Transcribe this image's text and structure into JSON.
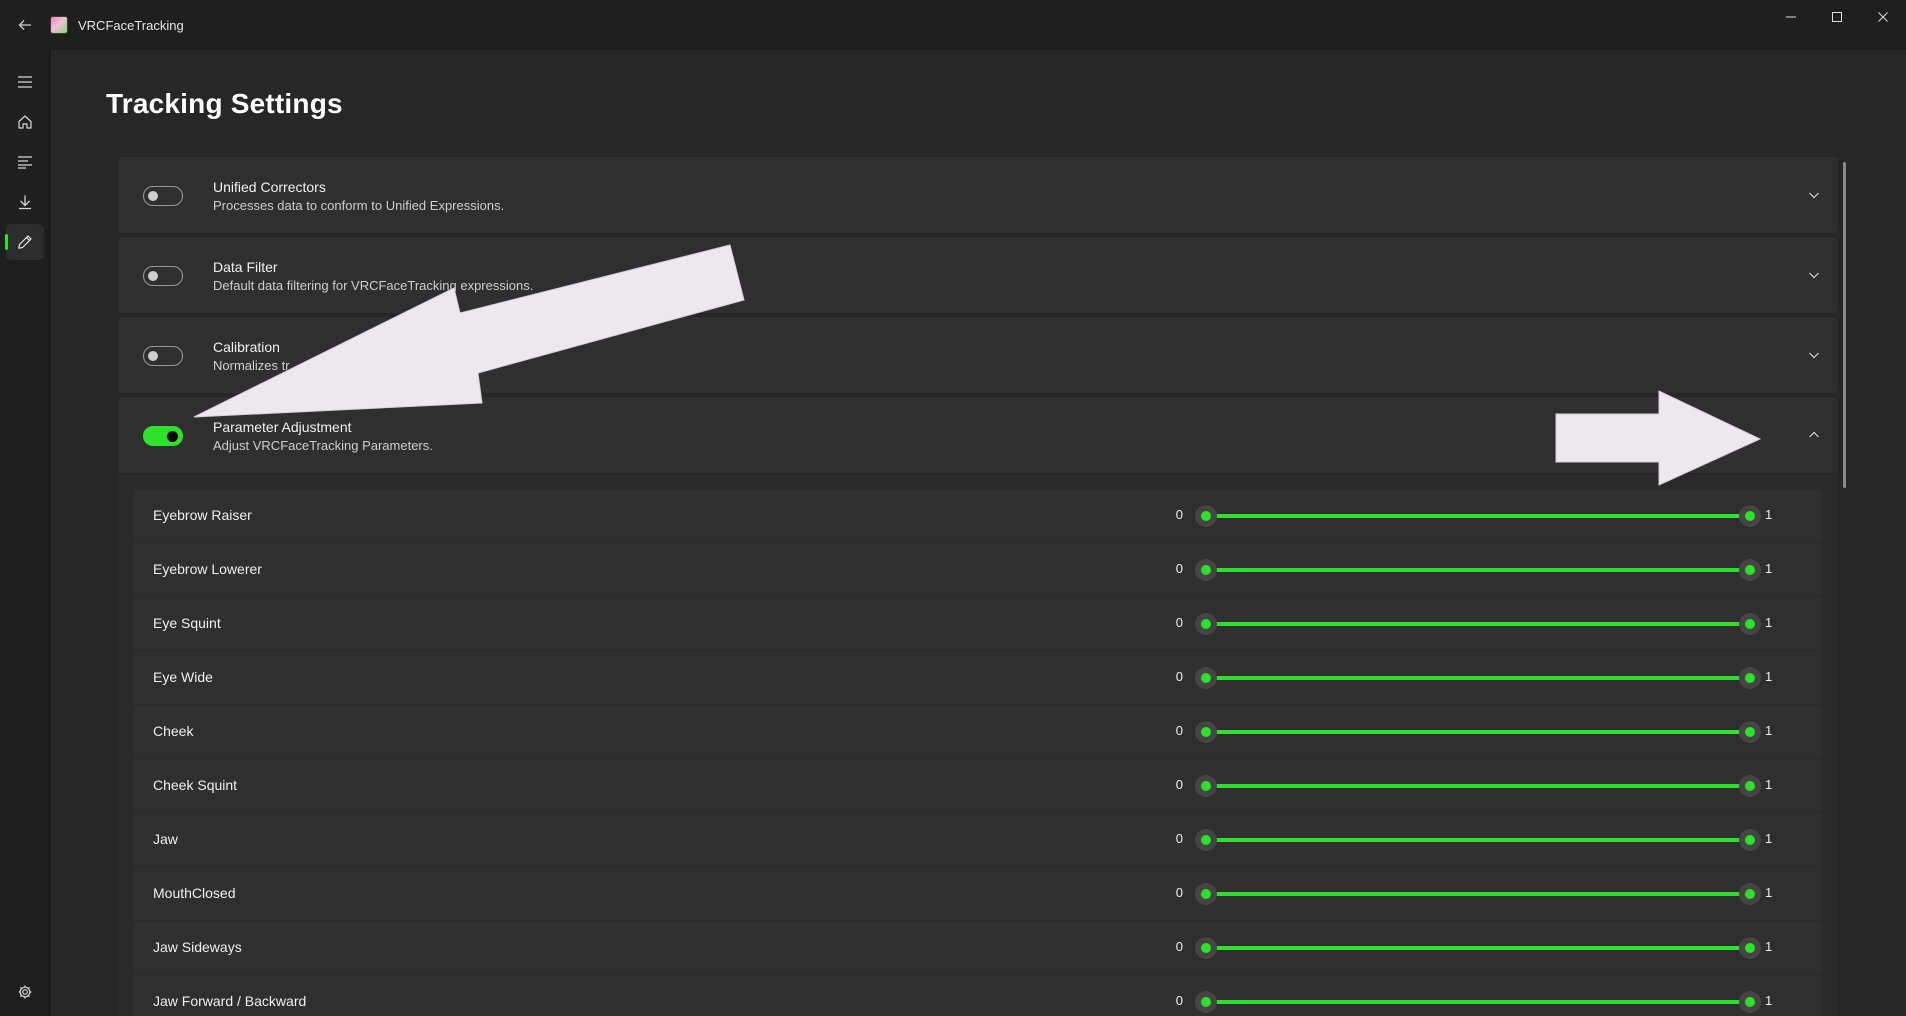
{
  "app": {
    "title": "VRCFaceTracking",
    "accent": "#2ee12a"
  },
  "nav": {
    "items": [
      {
        "name": "menu",
        "icon": "hamburger-icon"
      },
      {
        "name": "home",
        "icon": "home-icon"
      },
      {
        "name": "output",
        "icon": "list-icon"
      },
      {
        "name": "modules",
        "icon": "download-icon"
      },
      {
        "name": "tracking-settings",
        "icon": "pencil-icon",
        "active": true
      },
      {
        "name": "settings",
        "icon": "gear-icon"
      }
    ]
  },
  "page": {
    "title": "Tracking Settings"
  },
  "modules": [
    {
      "title": "Unified Correctors",
      "description": "Processes data to conform to Unified Expressions.",
      "enabled": false
    },
    {
      "title": "Data Filter",
      "description": "Default data filtering for VRCFaceTracking expressions.",
      "enabled": false
    },
    {
      "title": "Calibration",
      "description": "Normalizes tr",
      "enabled": false
    },
    {
      "title": "Parameter Adjustment",
      "description": "Adjust VRCFaceTracking Parameters.",
      "enabled": true
    }
  ],
  "parameters": [
    {
      "label": "Eyebrow Raiser",
      "min": "0",
      "max": "1"
    },
    {
      "label": "Eyebrow Lowerer",
      "min": "0",
      "max": "1"
    },
    {
      "label": "Eye Squint",
      "min": "0",
      "max": "1"
    },
    {
      "label": "Eye Wide",
      "min": "0",
      "max": "1"
    },
    {
      "label": "Cheek",
      "min": "0",
      "max": "1"
    },
    {
      "label": "Cheek Squint",
      "min": "0",
      "max": "1"
    },
    {
      "label": "Jaw",
      "min": "0",
      "max": "1"
    },
    {
      "label": "MouthClosed",
      "min": "0",
      "max": "1"
    },
    {
      "label": "Jaw Sideways",
      "min": "0",
      "max": "1"
    },
    {
      "label": "Jaw Forward / Backward",
      "min": "0",
      "max": "1"
    }
  ]
}
